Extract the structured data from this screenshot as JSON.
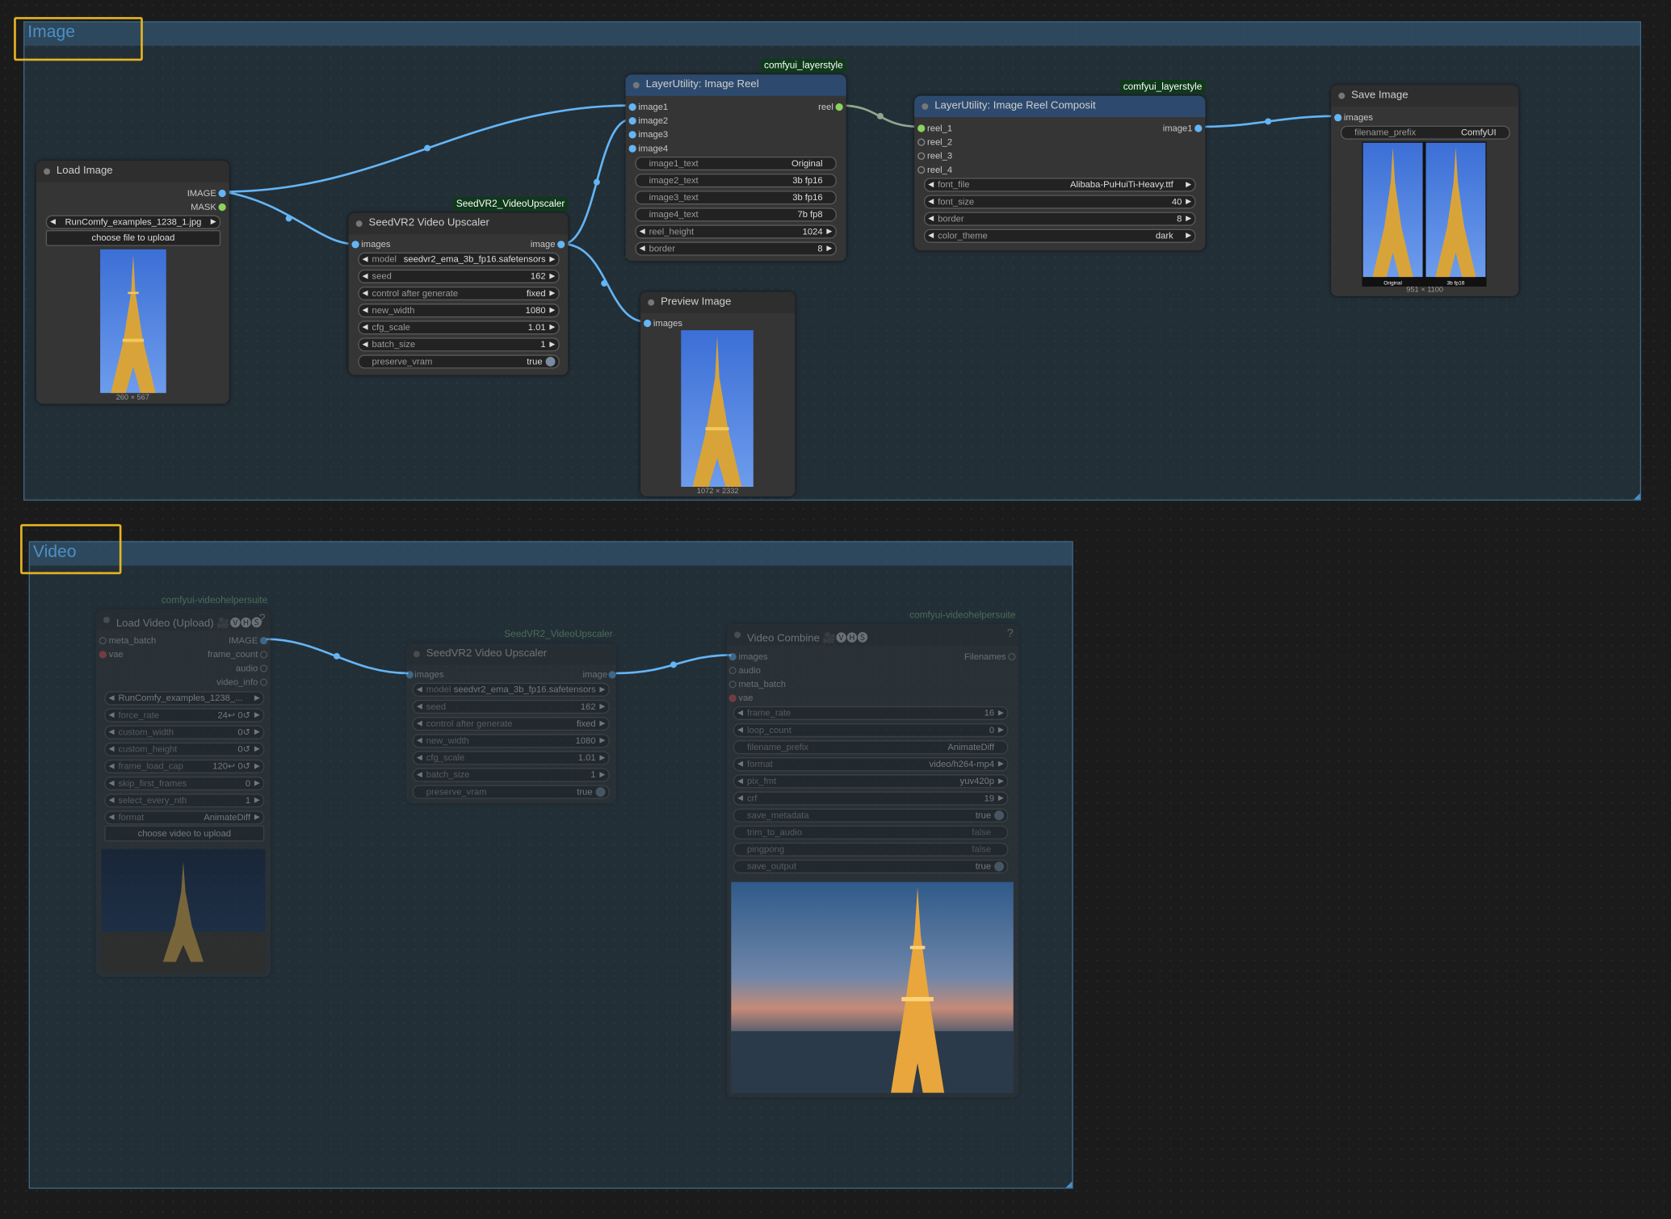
{
  "colors": {
    "accent": "#4d8fc6",
    "link": "#64b5f6",
    "highlight": "#e6b422",
    "group_fill": "#3a6482",
    "background": "#1b1b1b"
  },
  "groups": {
    "image": {
      "title": "Image"
    },
    "video": {
      "title": "Video"
    }
  },
  "load_image": {
    "title": "Load Image",
    "out_image": "IMAGE",
    "out_mask": "MASK",
    "file": "RunComfy_examples_1238_1.jpg",
    "upload": "choose file to upload",
    "caption": "260 × 567"
  },
  "seedvr2": {
    "title": "SeedVR2 Video Upscaler",
    "badge": "SeedVR2_VideoUpscaler",
    "in_images": "images",
    "out_image": "image",
    "model_label": "model",
    "model_value": "seedvr2_ema_3b_fp16.safetensors",
    "seed_label": "seed",
    "seed_value": "162",
    "cag_label": "control after generate",
    "cag_value": "fixed",
    "nw_label": "new_width",
    "nw_value": "1080",
    "cfg_label": "cfg_scale",
    "cfg_value": "1.01",
    "bs_label": "batch_size",
    "bs_value": "1",
    "pv_label": "preserve_vram",
    "pv_value": "true"
  },
  "reel": {
    "title": "LayerUtility: Image Reel",
    "badge": "comfyui_layerstyle",
    "in1": "image1",
    "in2": "image2",
    "in3": "image3",
    "in4": "image4",
    "out": "reel",
    "t1_label": "image1_text",
    "t1_value": "Original",
    "t2_label": "image2_text",
    "t2_value": "3b fp16",
    "t3_label": "image3_text",
    "t3_value": "3b fp16",
    "t4_label": "image4_text",
    "t4_value": "7b fp8",
    "rh_label": "reel_height",
    "rh_value": "1024",
    "b_label": "border",
    "b_value": "8"
  },
  "composit": {
    "title": "LayerUtility: Image Reel Composit",
    "badge": "comfyui_layerstyle",
    "in1": "reel_1",
    "in2": "reel_2",
    "in3": "reel_3",
    "in4": "reel_4",
    "out": "image1",
    "ff_label": "font_file",
    "ff_value": "Alibaba-PuHuiTi-Heavy.ttf",
    "fs_label": "font_size",
    "fs_value": "40",
    "b_label": "border",
    "b_value": "8",
    "ct_label": "color_theme",
    "ct_value": "dark"
  },
  "save": {
    "title": "Save Image",
    "in": "images",
    "fp_label": "filename_prefix",
    "fp_value": "ComfyUI",
    "cap1": "Original",
    "cap2": "3b fp16",
    "caption": "951 × 1100"
  },
  "preview": {
    "title": "Preview Image",
    "in": "images",
    "caption": "1072 × 2332"
  },
  "load_video": {
    "title": "Load Video (Upload) 🎥🅥🅗🅢",
    "badge": "comfyui-videohelpersuite",
    "help": "?",
    "in_meta": "meta_batch",
    "in_vae": "vae",
    "out_image": "IMAGE",
    "out_fc": "frame_count",
    "out_audio": "audio",
    "out_vi": "video_info",
    "file": "RunComfy_examples_1238_...",
    "fr_label": "force_rate",
    "fr_value": "24↩ 0↺",
    "cw_label": "custom_width",
    "cw_value": "0↺",
    "ch_label": "custom_height",
    "ch_value": "0↺",
    "flc_label": "frame_load_cap",
    "flc_value": "120↩ 0↺",
    "sff_label": "skip_first_frames",
    "sff_value": "0",
    "sen_label": "select_every_nth",
    "sen_value": "1",
    "fmt_label": "format",
    "fmt_value": "AnimateDiff",
    "upload": "choose video to upload"
  },
  "seedvr2_v": {
    "title": "SeedVR2 Video Upscaler",
    "badge": "SeedVR2_VideoUpscaler",
    "in_images": "images",
    "out_image": "image",
    "model_label": "model",
    "model_value": "seedvr2_ema_3b_fp16.safetensors",
    "seed_label": "seed",
    "seed_value": "162",
    "cag_label": "control after generate",
    "cag_value": "fixed",
    "nw_label": "new_width",
    "nw_value": "1080",
    "cfg_label": "cfg_scale",
    "cfg_value": "1.01",
    "bs_label": "batch_size",
    "bs_value": "1",
    "pv_label": "preserve_vram",
    "pv_value": "true"
  },
  "video_combine": {
    "title": "Video Combine 🎥🅥🅗🅢",
    "badge": "comfyui-videohelpersuite",
    "help": "?",
    "in_images": "images",
    "in_audio": "audio",
    "in_meta": "meta_batch",
    "in_vae": "vae",
    "out": "Filenames",
    "fr_label": "frame_rate",
    "fr_value": "16",
    "lc_label": "loop_count",
    "lc_value": "0",
    "fp_label": "filename_prefix",
    "fp_value": "AnimateDiff",
    "fmt_label": "format",
    "fmt_value": "video/h264-mp4",
    "pf_label": "pix_fmt",
    "pf_value": "yuv420p",
    "crf_label": "crf",
    "crf_value": "19",
    "sm_label": "save_metadata",
    "sm_value": "true",
    "ta_label": "trim_to_audio",
    "ta_value": "false",
    "pp_label": "pingpong",
    "pp_value": "false",
    "so_label": "save_output",
    "so_value": "true"
  }
}
